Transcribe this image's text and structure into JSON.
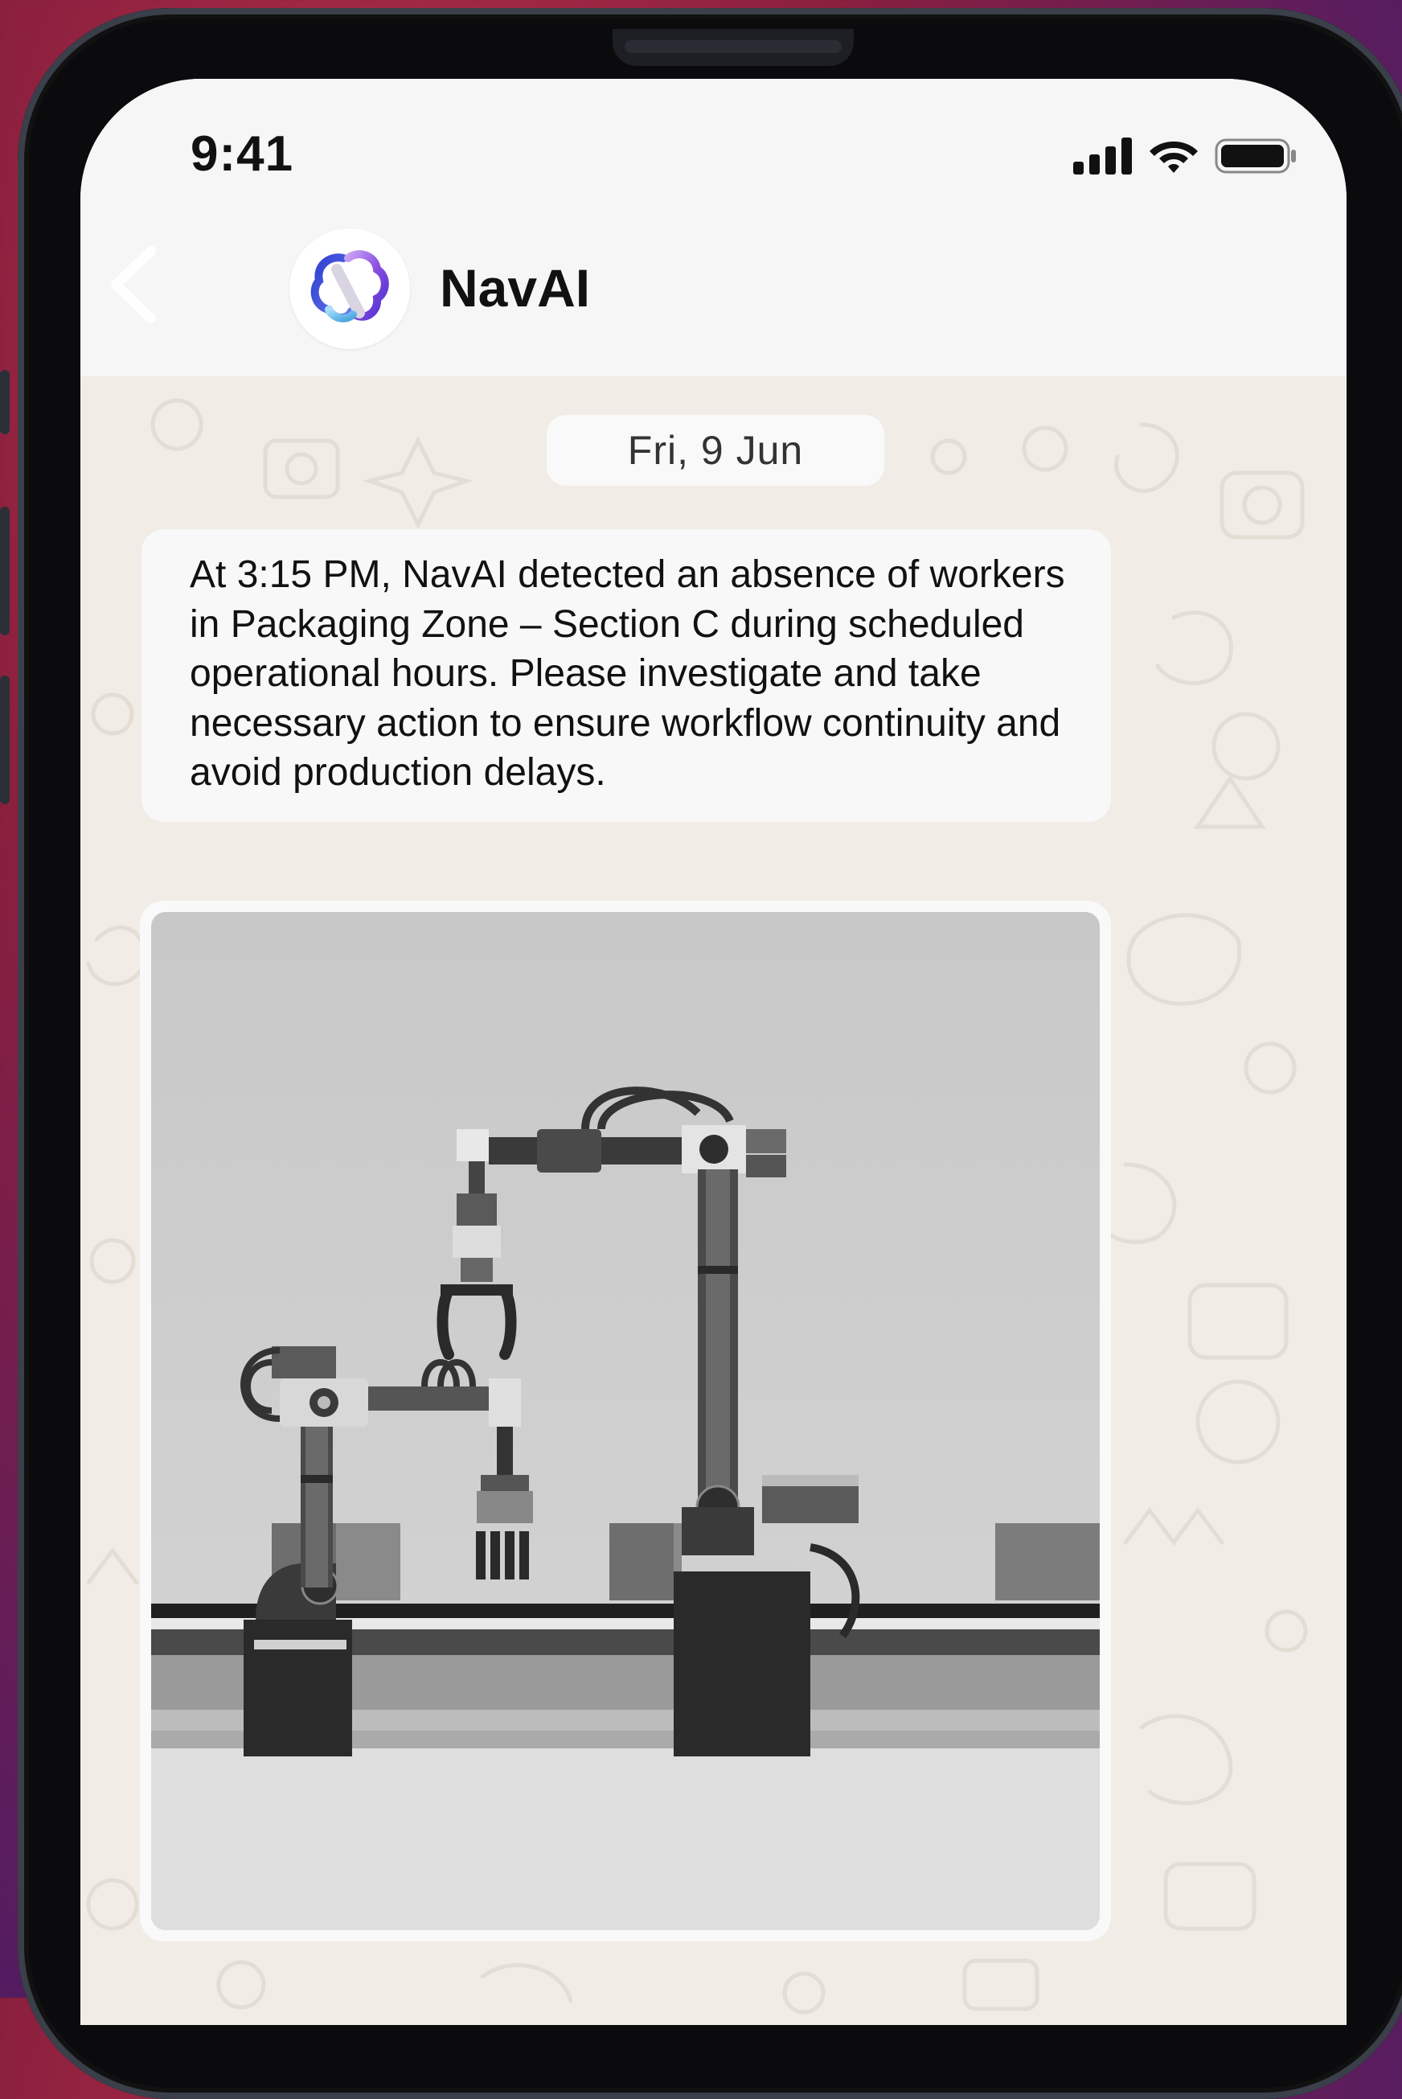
{
  "status_bar": {
    "time": "9:41"
  },
  "header": {
    "contact_name": "NavAI"
  },
  "chat": {
    "date_label": "Fri, 9 Jun",
    "messages": [
      {
        "text": "At 3:15 PM, NavAI detected an absence of workers in Packaging Zone – Section C during scheduled operational hours. Please investigate and take necessary action to ensure workflow continuity and avoid production delays."
      }
    ]
  },
  "colors": {
    "accent_blue": "#3d4fd8",
    "accent_purple": "#8a4fe0",
    "accent_cyan": "#5fb8e6",
    "chat_background": "#f1ece6"
  },
  "icons": [
    "signal-icon",
    "wifi-icon",
    "battery-icon",
    "back-chevron-icon",
    "navai-logo-icon"
  ]
}
